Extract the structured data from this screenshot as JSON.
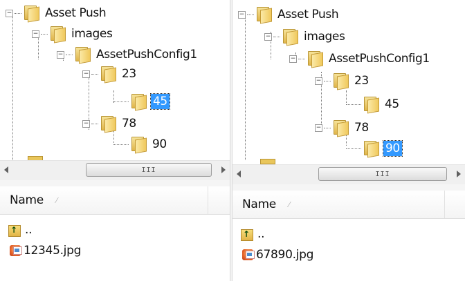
{
  "left_panel": {
    "tree": {
      "root": "Asset Push",
      "images": "images",
      "config": "AssetPushConfig1",
      "n23": "23",
      "n45": "45",
      "n78": "78",
      "n90": "90",
      "selected": "45"
    },
    "scrollbar_grip": "III",
    "files": {
      "column_name": "Name",
      "parent": "..",
      "file": "12345.jpg"
    }
  },
  "right_panel": {
    "tree": {
      "root": "Asset Push",
      "images": "images",
      "config": "AssetPushConfig1",
      "n23": "23",
      "n45": "45",
      "n78": "78",
      "n90": "90",
      "selected": "90"
    },
    "scrollbar_grip": "III",
    "files": {
      "column_name": "Name",
      "parent": "..",
      "file": "67890.jpg"
    }
  },
  "colors": {
    "selection": "#3399ff",
    "folder": "#f0c95c"
  }
}
